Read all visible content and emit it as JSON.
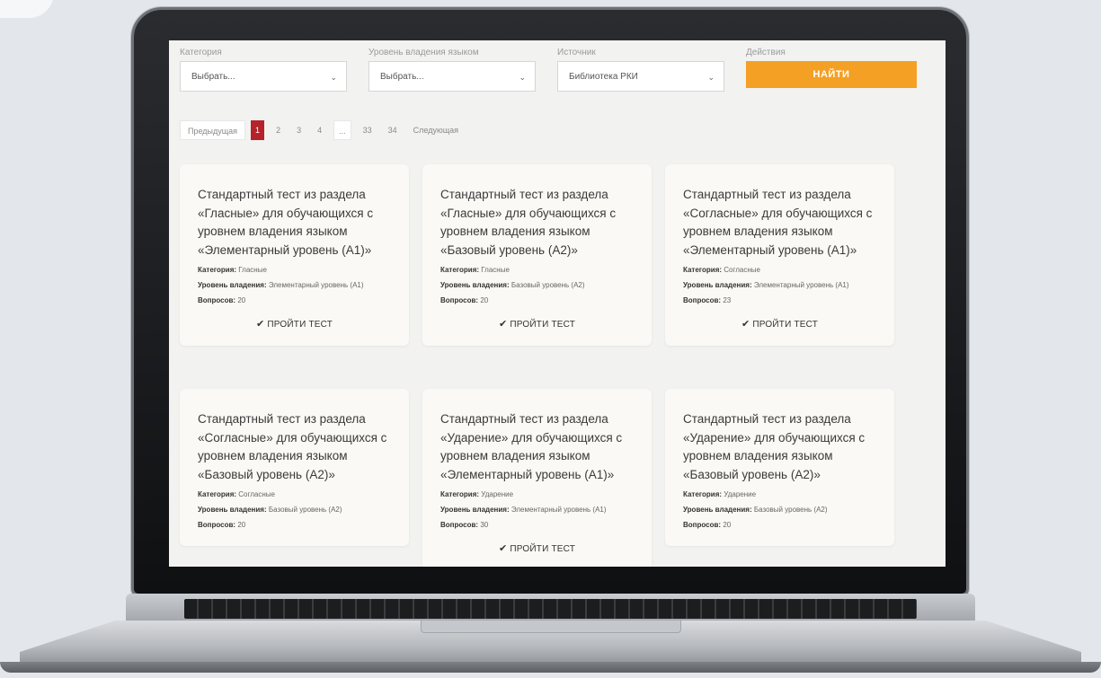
{
  "filters": [
    {
      "label": "Категория",
      "value": "Выбрать..."
    },
    {
      "label": "Уровень владения языком",
      "value": "Выбрать..."
    },
    {
      "label": "Источник",
      "value": "Библиотека РКИ"
    }
  ],
  "actions": {
    "label": "Действия",
    "button": "НАЙТИ"
  },
  "pagination": {
    "prev": "Предыдущая",
    "pages": [
      "1",
      "2",
      "3",
      "4",
      "...",
      "33",
      "34"
    ],
    "active": "1",
    "next": "Следующая"
  },
  "labels": {
    "category": "Категория:",
    "level": "Уровень владения:",
    "questions": "Вопросов:",
    "take": "ПРОЙТИ ТЕСТ"
  },
  "cards": [
    {
      "title": "Стандартный тест из раздела «Гласные» для обучающихся с уровнем владения языком «Элементарный уровень (А1)»",
      "category": "Гласные",
      "level": "Элементарный уровень (А1)",
      "questions": "20"
    },
    {
      "title": "Стандартный тест из раздела «Гласные» для обучающихся с уровнем владения языком «Базовый уровень (А2)»",
      "category": "Гласные",
      "level": "Базовый уровень (А2)",
      "questions": "20"
    },
    {
      "title": "Стандартный тест из раздела «Согласные» для обучающихся с уровнем владения языком «Элементарный уровень (А1)»",
      "category": "Согласные",
      "level": "Элементарный уровень (А1)",
      "questions": "23"
    },
    {
      "title": "Стандартный тест из раздела «Согласные» для обучающихся с уровнем владения языком «Базовый уровень (А2)»",
      "category": "Согласные",
      "level": "Базовый уровень (А2)",
      "questions": "20"
    },
    {
      "title": "Стандартный тест из раздела «Ударение» для обучающихся с уровнем владения языком «Элементарный уровень (А1)»",
      "category": "Ударение",
      "level": "Элементарный уровень (А1)",
      "questions": "30"
    },
    {
      "title": "Стандартный тест из раздела «Ударение» для обучающихся с уровнем владения языком «Базовый уровень (А2)»",
      "category": "Ударение",
      "level": "Базовый уровень (А2)",
      "questions": "20"
    }
  ],
  "colors": {
    "accent": "#f4a024",
    "active_page": "#b5222b"
  }
}
